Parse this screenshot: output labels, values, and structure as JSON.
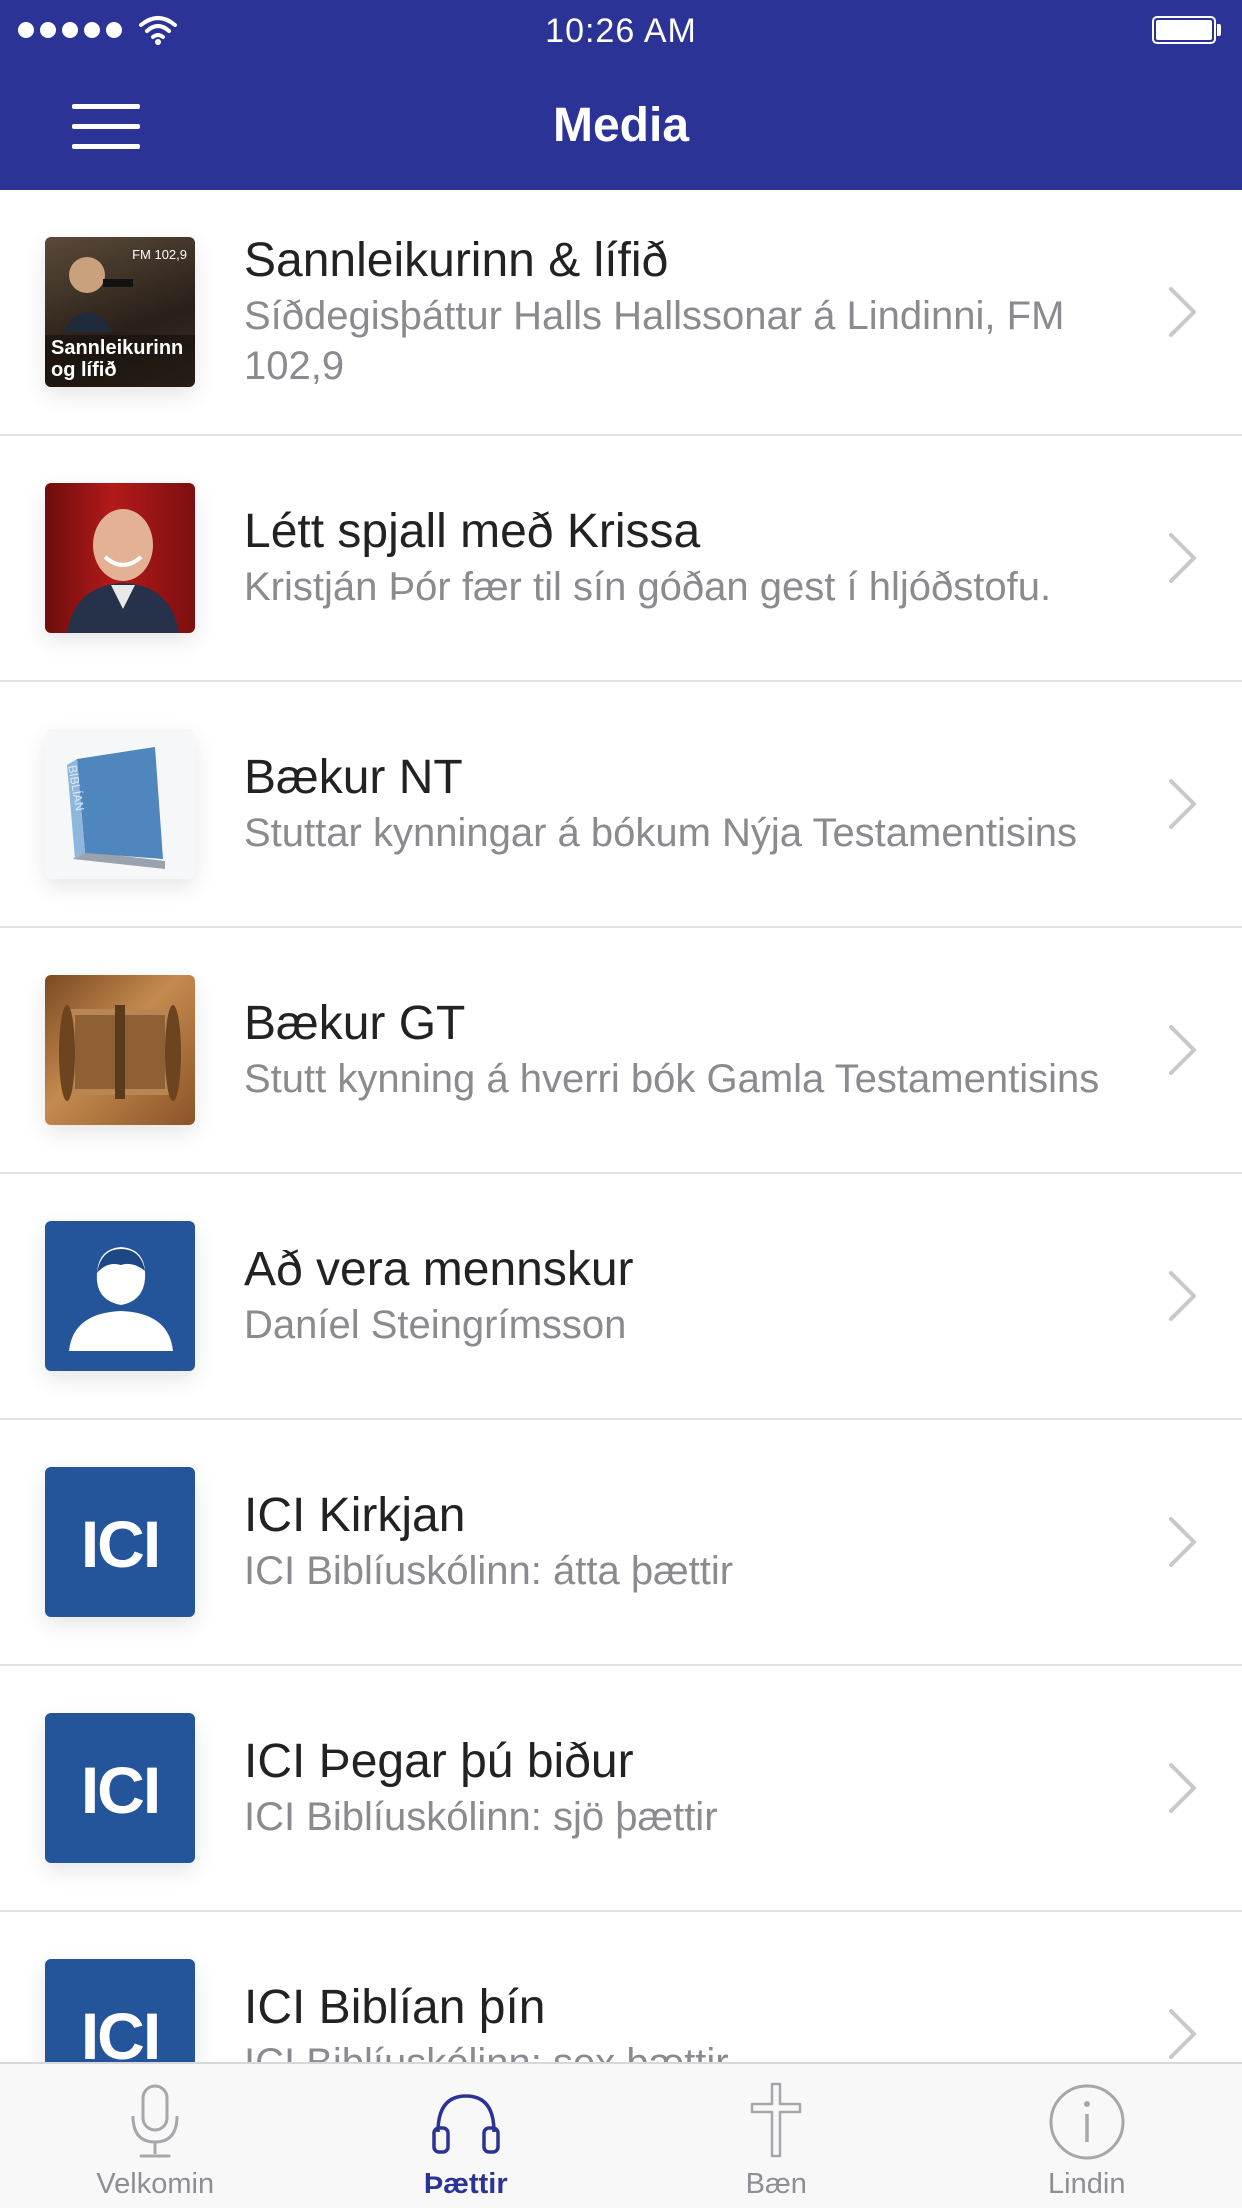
{
  "status_bar": {
    "time": "10:26 AM",
    "signal_icon": "signal-dots-icon",
    "wifi_icon": "wifi-icon",
    "battery_icon": "battery-full-icon"
  },
  "header": {
    "title": "Media",
    "menu_icon": "hamburger-menu-icon",
    "background_color": "#2b3496"
  },
  "list": {
    "items": [
      {
        "title": "Sannleikurinn & lífið",
        "subtitle": "Síðdegisþáttur Halls Hallssonar á Lindinni, FM 102,9",
        "thumb_text": "Sannleikurinn og lífið",
        "thumb_badge": "FM 102,9"
      },
      {
        "title": "Létt spjall með Krissa",
        "subtitle": "Kristján Þór fær til sín góðan gest í hljóðstofu.",
        "thumb_text": "",
        "thumb_badge": ""
      },
      {
        "title": "Bækur NT",
        "subtitle": "Stuttar kynningar á bókum Nýja Testamentisins",
        "thumb_text": "BIBLÍAN",
        "thumb_badge": ""
      },
      {
        "title": "Bækur GT",
        "subtitle": "Stutt kynning á hverri bók Gamla Testamentisins",
        "thumb_text": "",
        "thumb_badge": ""
      },
      {
        "title": "Að vera mennskur",
        "subtitle": "Daníel Steingrímsson",
        "thumb_text": "",
        "thumb_badge": ""
      },
      {
        "title": "ICI Kirkjan",
        "subtitle": "ICI Biblíuskólinn: átta þættir",
        "thumb_text": "ICI",
        "thumb_badge": ""
      },
      {
        "title": "ICI Þegar þú biður",
        "subtitle": "ICI Biblíuskólinn: sjö þættir",
        "thumb_text": "ICI",
        "thumb_badge": ""
      },
      {
        "title": "ICI Biblían þín",
        "subtitle": "ICI Biblíuskólinn: sex þættir",
        "thumb_text": "ICI",
        "thumb_badge": ""
      }
    ],
    "chevron_icon": "chevron-right-icon"
  },
  "tab_bar": {
    "tabs": [
      {
        "label": "Velkomin",
        "icon": "microphone-icon",
        "active": false
      },
      {
        "label": "Þættir",
        "icon": "headphones-icon",
        "active": true
      },
      {
        "label": "Bæn",
        "icon": "cross-icon",
        "active": false
      },
      {
        "label": "Lindin",
        "icon": "info-icon",
        "active": false
      }
    ],
    "active_color": "#2b3496",
    "inactive_color": "#8e8e93"
  }
}
